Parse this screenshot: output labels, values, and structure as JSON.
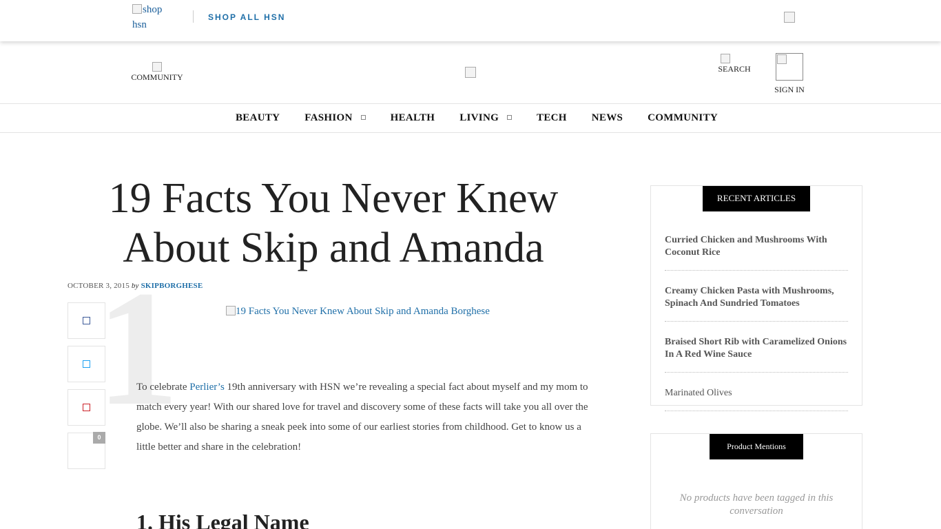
{
  "topbar": {
    "logo_alt": "shop hsn",
    "shop_all": "SHOP ALL HSN"
  },
  "header": {
    "community": "COMMUNITY",
    "search": "SEARCH",
    "sign_in": "SIGN IN"
  },
  "nav": {
    "items": [
      {
        "label": "BEAUTY"
      },
      {
        "label": "FASHION"
      },
      {
        "label": "HEALTH"
      },
      {
        "label": "LIVING"
      },
      {
        "label": "TECH"
      },
      {
        "label": "NEWS"
      },
      {
        "label": "COMMUNITY"
      }
    ]
  },
  "article": {
    "title": "19 Facts You Never Knew About Skip and Amanda",
    "date": "OCTOBER 3, 2015",
    "by": "by",
    "author": "SKIPBORGHESE",
    "hero_alt": "19 Facts You Never Knew About Skip and Amanda Borghese",
    "big_number": "1",
    "share_count": "0",
    "intro_before": "To celebrate ",
    "intro_link": "Perlier’s",
    "intro_after": " 19th anniversary with HSN we’re revealing a special fact about myself and my mom to match every year! With our shared love for travel and discovery some of these facts will take you all over the globe. We’ll also be sharing a sneak peek into some of our earliest stories from childhood. Get to know us a little better and share in the celebration!",
    "subhead": "1. His Legal Name"
  },
  "sidebar": {
    "recent_title": "RECENT ARTICLES",
    "recent": [
      "Curried Chicken and Mushrooms With Coconut Rice",
      "Creamy Chicken Pasta with Mushrooms, Spinach And Sundried Tomatoes",
      "Braised Short Rib with Caramelized Onions In A Red Wine Sauce",
      "Marinated Olives"
    ],
    "products_title": "Product Mentions",
    "no_products": "No products have been tagged in this conversation"
  }
}
